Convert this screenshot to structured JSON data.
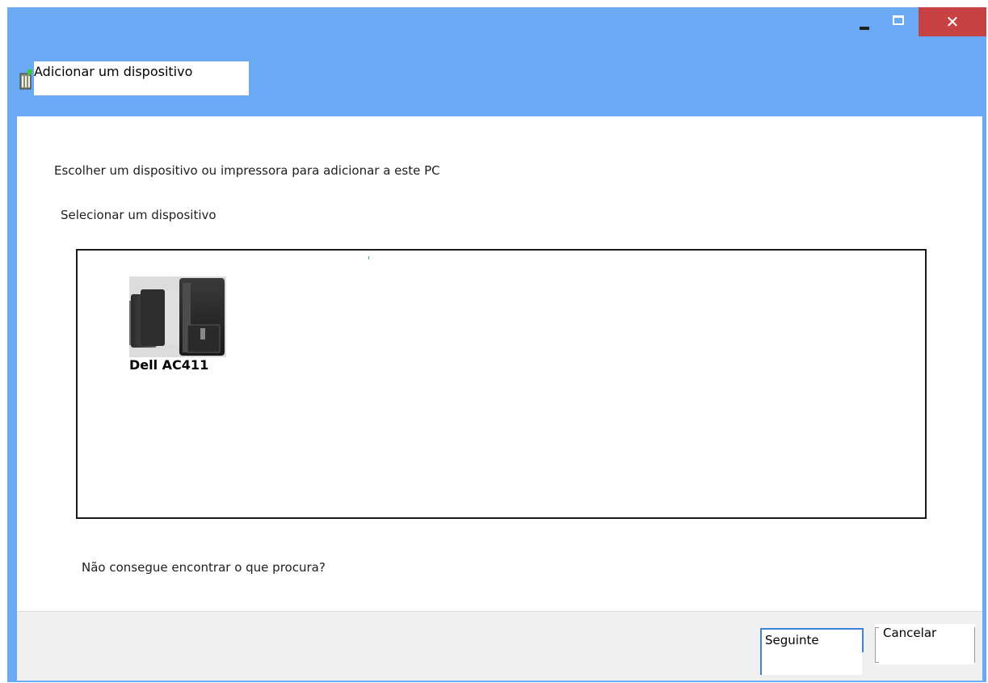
{
  "window": {
    "title": "Adicionar um dispositivo",
    "controls": {
      "minimize": "minimize-icon",
      "maximize": "maximize-icon",
      "close": "close-icon",
      "close_glyph": "✕"
    },
    "icon": "device-wizard-icon"
  },
  "main": {
    "heading": "Escolher um dispositivo ou impressora para adicionar a este PC",
    "subheading": "Selecionar um dispositivo",
    "devices": [
      {
        "name": "Dell AC411",
        "icon": "speaker-icon"
      }
    ],
    "help_link": "Não consegue encontrar o que procura?"
  },
  "footer": {
    "next_label": "Seguinte",
    "cancel_label": "Cancelar"
  },
  "colors": {
    "titlebar": "#6aaaf5",
    "close_button": "#c74343",
    "footer": "#f0f0f0",
    "focus_border": "#3b84d8"
  }
}
